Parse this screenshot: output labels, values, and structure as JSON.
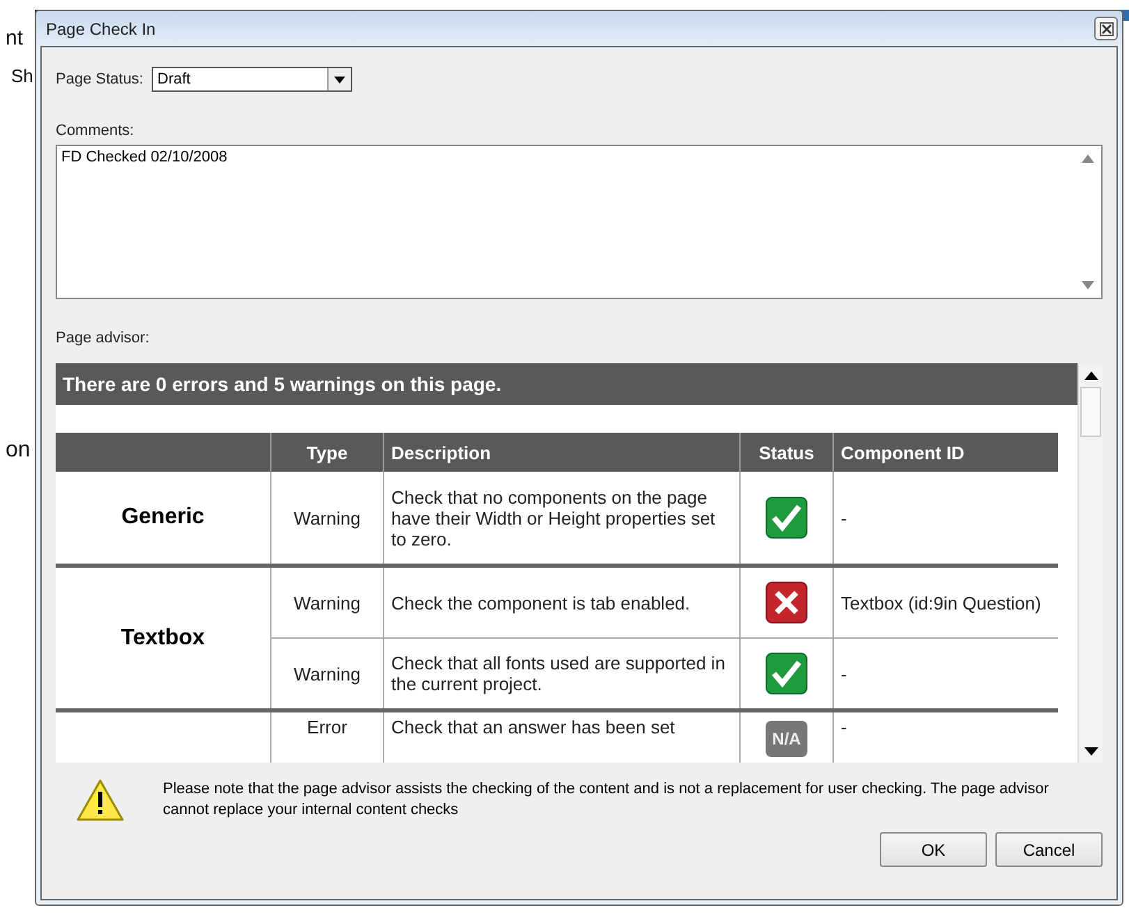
{
  "background": {
    "texts": [
      "nt",
      "Sh",
      "on"
    ]
  },
  "window": {
    "title": "Page Check In"
  },
  "page_status": {
    "label": "Page Status:",
    "value": "Draft"
  },
  "comments": {
    "label": "Comments:",
    "value": "FD Checked 02/10/2008"
  },
  "advisor": {
    "label": "Page advisor:",
    "summary": "There are 0 errors and 5 warnings on this page.",
    "columns": [
      "Type",
      "Description",
      "Status",
      "Component ID"
    ],
    "groups": [
      {
        "name": "Generic",
        "checks": [
          {
            "type": "Warning",
            "description": "Check that no components on the page have their Width or Height properties set to zero.",
            "kind": "pass",
            "component": "-"
          }
        ]
      },
      {
        "name": "Textbox",
        "checks": [
          {
            "type": "Warning",
            "description": "Check the component is tab enabled.",
            "kind": "fail",
            "component": "Textbox (id:9in Question)"
          },
          {
            "type": "Warning",
            "description": "Check that all fonts used are supported in the current project.",
            "kind": "pass",
            "component": "-"
          }
        ]
      },
      {
        "checks": [
          {
            "type": "Error",
            "description": "Check that an answer has been set",
            "kind": "na",
            "status_label": "N/A",
            "component": "-"
          }
        ]
      }
    ]
  },
  "notice": "Please note that the page advisor assists the checking of the content and is not a replacement for user checking. The page advisor cannot replace your internal content checks",
  "buttons": [
    "OK",
    "Cancel"
  ]
}
